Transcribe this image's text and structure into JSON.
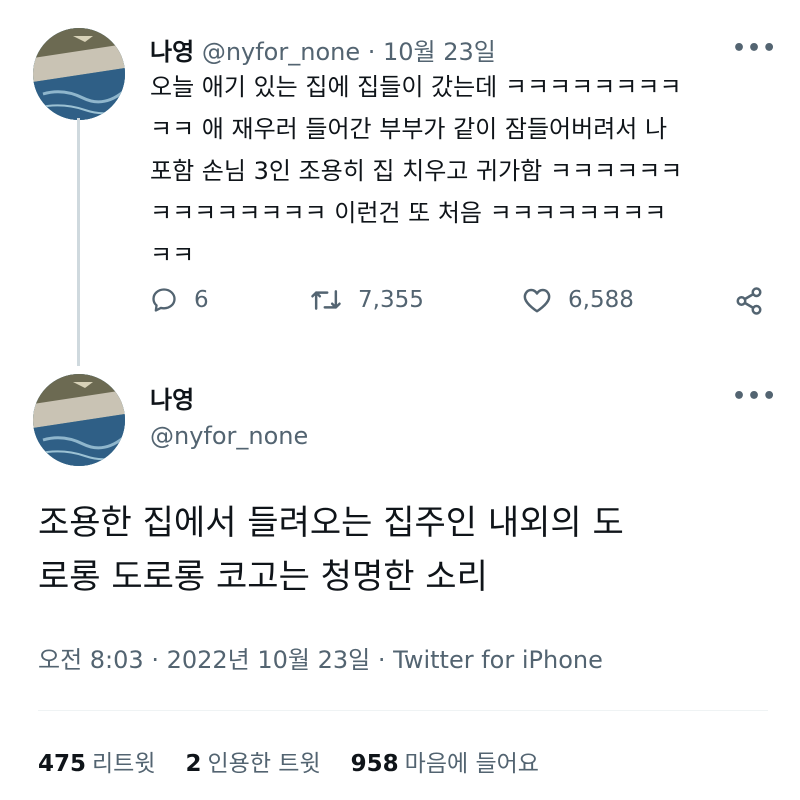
{
  "tweet": {
    "name": "나영",
    "handle": "@nyfor_none",
    "date": "10월 23일",
    "text": "오늘 애기 있는 집에 집들이 갔는데 ㅋㅋㅋㅋㅋㅋㅋㅋ\nㅋㅋ 애 재우러 들어간 부부가 같이 잠들어버려서 나\n포함 손님 3인 조용히 집 치우고 귀가함 ㅋㅋㅋㅋㅋㅋ\nㅋㅋㅋㅋㅋㅋㅋㅋ 이런건 또 처음 ㅋㅋㅋㅋㅋㅋㅋㅋ\nㅋㅋ",
    "replies": "6",
    "retweets": "7,355",
    "likes": "6,588"
  },
  "reply": {
    "name": "나영",
    "handle": "@nyfor_none",
    "text": "조용한 집에서 들려오는 집주인 내외의 도\n로롱 도로롱 코고는 청명한 소리",
    "time": "오전 8:03",
    "date": "2022년 10월 23일",
    "source": "Twitter for iPhone",
    "stats": {
      "retweets_count": "475",
      "retweets_label": "리트윗",
      "quotes_count": "2",
      "quotes_label": "인용한 트윗",
      "likes_count": "958",
      "likes_label": "마음에 들어요"
    }
  },
  "icons": [
    "more-icon",
    "reply-icon",
    "retweet-icon",
    "like-icon",
    "share-icon"
  ],
  "colors": {
    "text": "#0f1419",
    "muted": "#536471",
    "thread_line": "#cfd9de"
  }
}
